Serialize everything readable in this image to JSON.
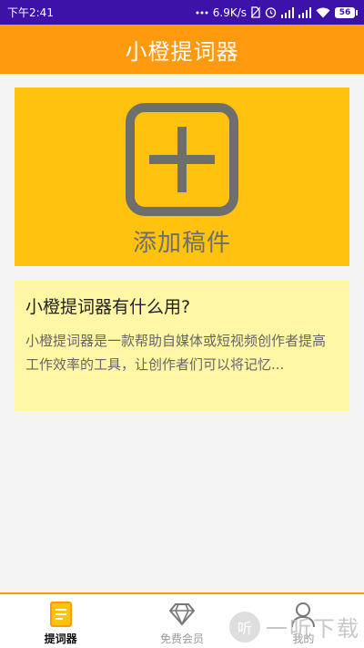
{
  "statusbar": {
    "time": "下午2:41",
    "network_speed": "6.9K/s",
    "battery_level": "56",
    "icons": [
      "more-dots-icon",
      "no-sim-icon",
      "alarm-icon",
      "signal-icon",
      "signal-icon",
      "wifi-icon",
      "battery-icon"
    ]
  },
  "appbar": {
    "title": "小橙提词器"
  },
  "add_card": {
    "label": "添加稿件",
    "icon": "plus-box-icon"
  },
  "info_card": {
    "title": "小橙提词器有什么用?",
    "description": "小橙提词器是一款帮助自媒体或短视频创作者提高工作效率的工具，让创作者们可以将记忆..."
  },
  "bottom_nav": {
    "items": [
      {
        "label": "提词器",
        "icon": "document-icon",
        "active": true
      },
      {
        "label": "免费会员",
        "icon": "diamond-icon",
        "active": false
      },
      {
        "label": "我的",
        "icon": "person-icon",
        "active": false
      }
    ]
  },
  "watermark": {
    "text": "一听下载",
    "badge": "听"
  },
  "colors": {
    "statusbar": "#3d12a8",
    "accent": "#ff9a0f",
    "add_card": "#ffc20e",
    "info_card": "#fff6a6",
    "icon_gray": "#6e6e6e"
  }
}
